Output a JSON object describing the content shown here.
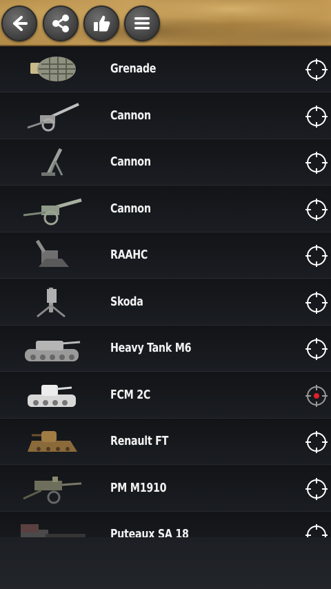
{
  "toolbar": {
    "back_icon": "back-arrow-icon",
    "share_icon": "share-icon",
    "like_icon": "thumbs-up-icon",
    "menu_icon": "menu-icon"
  },
  "items": [
    {
      "label": "Grenade",
      "thumb": "grenade",
      "selected": false
    },
    {
      "label": "Cannon",
      "thumb": "field-gun",
      "selected": false
    },
    {
      "label": "Cannon",
      "thumb": "mortar",
      "selected": false
    },
    {
      "label": "Cannon",
      "thumb": "howitzer",
      "selected": false
    },
    {
      "label": "RAAHC",
      "thumb": "aa-gun",
      "selected": false
    },
    {
      "label": "Skoda",
      "thumb": "skoda-gun",
      "selected": false
    },
    {
      "label": "Heavy Tank M6",
      "thumb": "heavy-tank",
      "selected": false
    },
    {
      "label": "FCM 2C",
      "thumb": "fcm-tank",
      "selected": true
    },
    {
      "label": "Renault FT",
      "thumb": "renault-tank",
      "selected": false
    },
    {
      "label": "PM M1910",
      "thumb": "machine-gun",
      "selected": false
    },
    {
      "label": "Puteaux SA 18",
      "thumb": "puteaux-gun",
      "selected": false
    }
  ],
  "colors": {
    "selected_dot": "#e0202a",
    "target_stroke": "#ffffff",
    "target_stroke_selected": "#9a9a9a"
  }
}
